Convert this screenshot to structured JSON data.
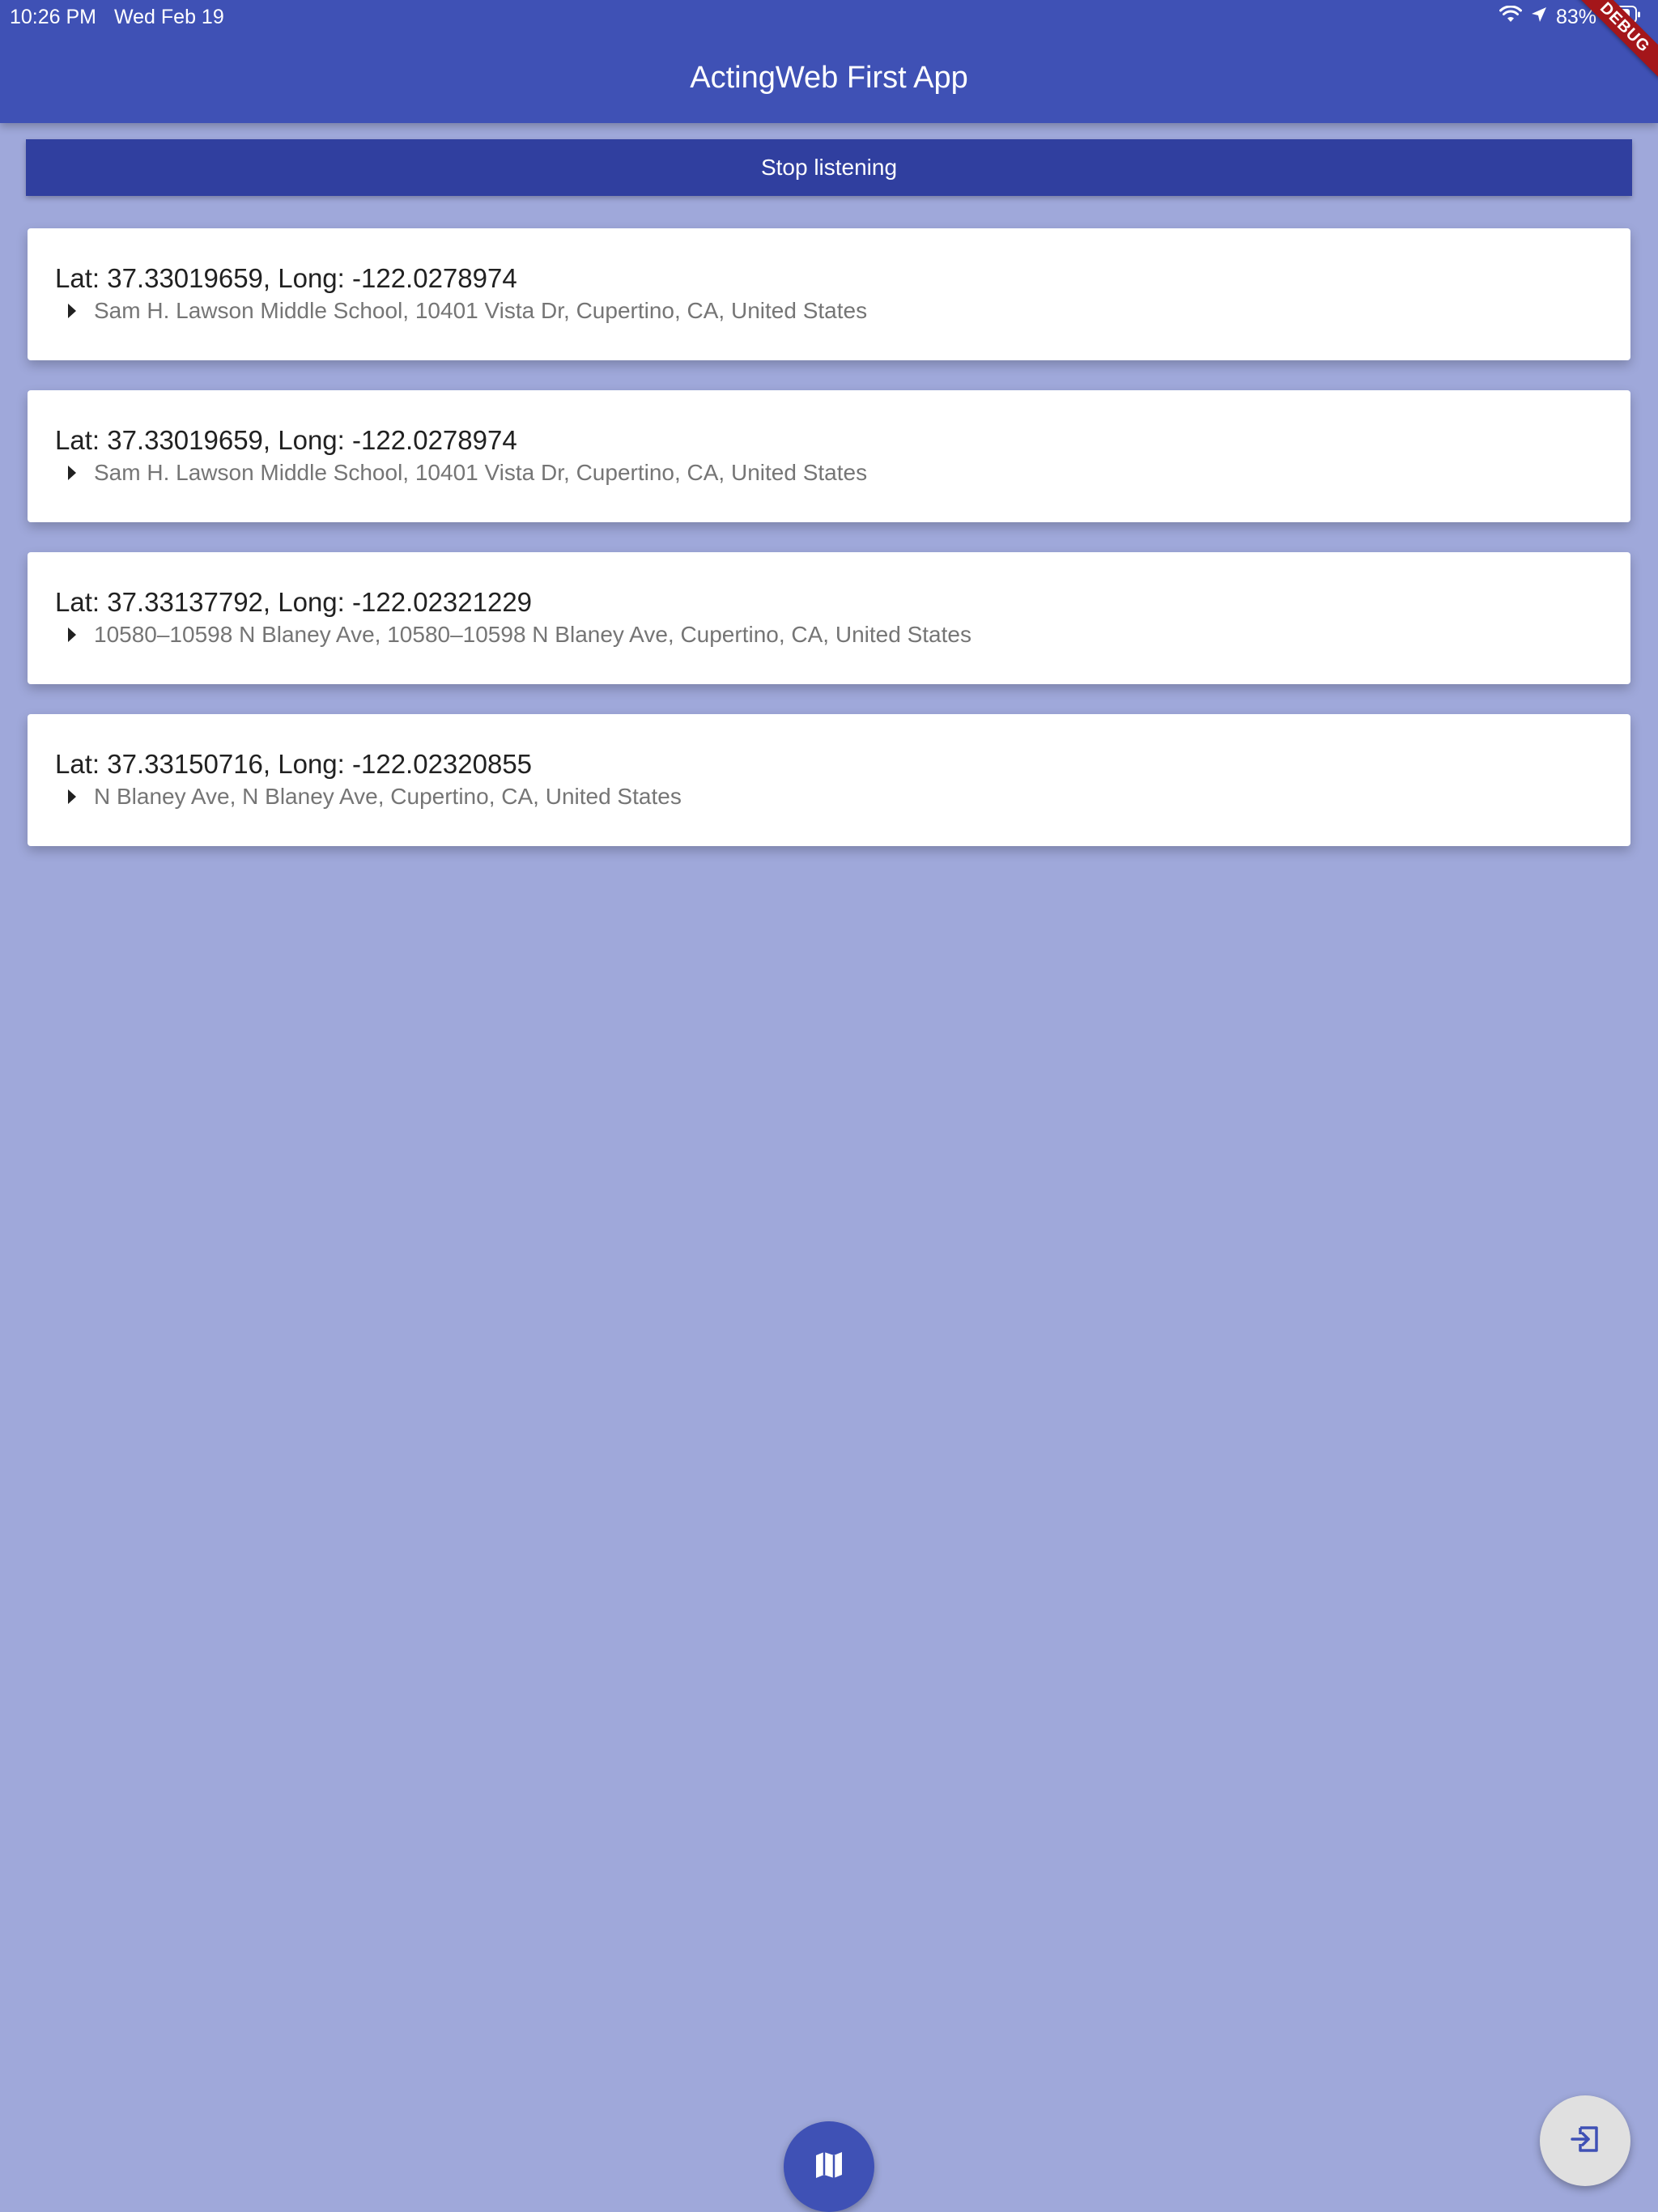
{
  "status_bar": {
    "time": "10:26 PM",
    "date": "Wed Feb 19",
    "battery": "83%"
  },
  "app_bar": {
    "title": "ActingWeb First App",
    "debug_banner": "DEBUG"
  },
  "controls": {
    "stop_listening_label": "Stop listening"
  },
  "locations": [
    {
      "coords": "Lat: 37.33019659, Long: -122.0278974",
      "address": "Sam H. Lawson Middle School, 10401 Vista Dr, Cupertino, CA, United States"
    },
    {
      "coords": "Lat: 37.33019659, Long: -122.0278974",
      "address": "Sam H. Lawson Middle School, 10401 Vista Dr, Cupertino, CA, United States"
    },
    {
      "coords": "Lat: 37.33137792, Long: -122.02321229",
      "address": "10580–10598 N Blaney Ave, 10580–10598 N Blaney Ave, Cupertino, CA, United States"
    },
    {
      "coords": "Lat: 37.33150716, Long: -122.02320855",
      "address": "N Blaney Ave,  N Blaney Ave, Cupertino, CA, United States"
    }
  ],
  "fabs": {
    "map": {
      "icon": "map-icon"
    },
    "exit": {
      "icon": "exit-to-app-icon"
    }
  },
  "colors": {
    "primary": "#3f51b5",
    "primary_dark": "#303f9f",
    "background": "#9fa8da",
    "exit_icon": "#3f51b5"
  }
}
